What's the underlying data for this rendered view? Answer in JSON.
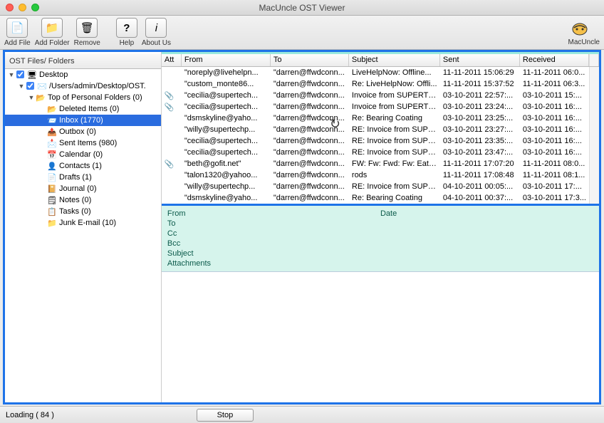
{
  "window": {
    "title": "MacUncle OST Viewer"
  },
  "toolbar": {
    "add_file": "Add File",
    "add_folder": "Add Folder",
    "remove": "Remove",
    "help": "Help",
    "about": "About Us",
    "brand": "MacUncle"
  },
  "sidebar": {
    "tab": "OST Files/ Folders",
    "desktop": "Desktop",
    "path": "/Users/admin/Desktop/OST.",
    "top": "Top of Personal Folders (0)",
    "items": [
      {
        "label": "Deleted Items (0)",
        "icon": "📂"
      },
      {
        "label": "Inbox (1770)",
        "icon": "📨",
        "selected": true
      },
      {
        "label": "Outbox (0)",
        "icon": "📤"
      },
      {
        "label": "Sent Items (980)",
        "icon": "📩"
      },
      {
        "label": "Calendar (0)",
        "icon": "📅"
      },
      {
        "label": "Contacts (1)",
        "icon": "👤"
      },
      {
        "label": "Drafts (1)",
        "icon": "📄"
      },
      {
        "label": "Journal (0)",
        "icon": "📔"
      },
      {
        "label": "Notes (0)",
        "icon": "🗒"
      },
      {
        "label": "Tasks (0)",
        "icon": "📋"
      },
      {
        "label": "Junk E-mail (10)",
        "icon": "📁"
      }
    ]
  },
  "grid": {
    "headers": {
      "att": "Att",
      "from": "From",
      "to": "To",
      "subject": "Subject",
      "sent": "Sent",
      "received": "Received"
    },
    "rows": [
      {
        "att": "",
        "from": "\"noreply@livehelpn...",
        "to": "\"darren@ffwdconn...",
        "subject": "LiveHelpNow: Offline...",
        "sent": "11-11-2011 15:06:29",
        "received": "11-11-2011 06:0..."
      },
      {
        "att": "",
        "from": "\"custom_monte86...",
        "to": "\"darren@ffwdconn...",
        "subject": "Re: LiveHelpNow: Offli...",
        "sent": "11-11-2011 15:37:52",
        "received": "11-11-2011 06:3..."
      },
      {
        "att": "📎",
        "from": "\"cecilia@supertech...",
        "to": "\"darren@ffwdconn...",
        "subject": "Invoice from SUPERTE...",
        "sent": "03-10-2011 22:57:...",
        "received": "03-10-2011 15:..."
      },
      {
        "att": "📎",
        "from": "\"cecilia@supertech...",
        "to": "\"darren@ffwdconn...",
        "subject": "Invoice from SUPERTE...",
        "sent": "03-10-2011 23:24:...",
        "received": "03-10-2011 16:..."
      },
      {
        "att": "",
        "from": "\"dsmskyline@yaho...",
        "to": "\"darren@ffwdconn...",
        "subject": "Re: Bearing Coating",
        "sent": "03-10-2011 23:25:...",
        "received": "03-10-2011 16:..."
      },
      {
        "att": "",
        "from": "\"willy@supertechp...",
        "to": "\"darren@ffwdconn...",
        "subject": "RE: Invoice from SUPE...",
        "sent": "03-10-2011 23:27:...",
        "received": "03-10-2011 16:..."
      },
      {
        "att": "",
        "from": "\"cecilia@supertech...",
        "to": "\"darren@ffwdconn...",
        "subject": "RE: Invoice from SUPE...",
        "sent": "03-10-2011 23:35:...",
        "received": "03-10-2011 16:..."
      },
      {
        "att": "",
        "from": "\"cecilia@supertech...",
        "to": "\"darren@ffwdconn...",
        "subject": "RE: Invoice from SUPE...",
        "sent": "03-10-2011 23:47:...",
        "received": "03-10-2011 16:..."
      },
      {
        "att": "📎",
        "from": "\"beth@gofit.net\"",
        "to": "\"darren@ffwdconn...",
        "subject": "FW: Fw: Fwd: Fw: Eat f...",
        "sent": "11-11-2011 17:07:20",
        "received": "11-11-2011 08:0..."
      },
      {
        "att": "",
        "from": "\"talon1320@yahoo...",
        "to": "\"darren@ffwdconn...",
        "subject": "rods",
        "sent": "11-11-2011 17:08:48",
        "received": "11-11-2011 08:1..."
      },
      {
        "att": "",
        "from": "\"willy@supertechp...",
        "to": "\"darren@ffwdconn...",
        "subject": "RE: Invoice from SUPE...",
        "sent": "04-10-2011 00:05:...",
        "received": "03-10-2011 17:..."
      },
      {
        "att": "",
        "from": "\"dsmskyline@yaho...",
        "to": "\"darren@ffwdconn...",
        "subject": "Re: Bearing Coating",
        "sent": "04-10-2011 00:37:...",
        "received": "03-10-2011 17:3..."
      }
    ]
  },
  "preview": {
    "from": "From",
    "to": "To",
    "cc": "Cc",
    "bcc": "Bcc",
    "subject": "Subject",
    "attachments": "Attachments",
    "date": "Date"
  },
  "status": {
    "loading": "Loading ( 84 )",
    "stop": "Stop"
  }
}
